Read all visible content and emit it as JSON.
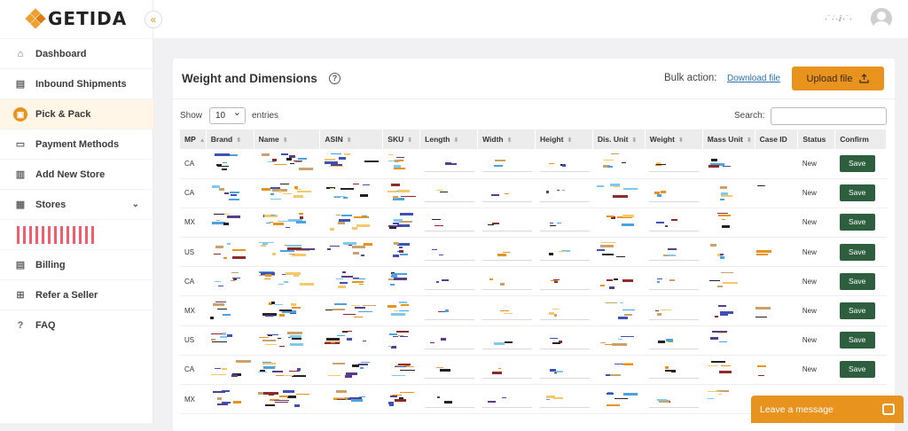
{
  "app": {
    "name": "GETIDA"
  },
  "sidebar": {
    "collapse_icon": "«",
    "items": [
      {
        "label": "Dashboard",
        "icon": "home-icon"
      },
      {
        "label": "Inbound Shipments",
        "icon": "truck-icon"
      },
      {
        "label": "Pick & Pack",
        "icon": "box-icon",
        "active": true
      },
      {
        "label": "Payment Methods",
        "icon": "card-icon"
      },
      {
        "label": "Add New Store",
        "icon": "store-icon"
      },
      {
        "label": "Stores",
        "icon": "stores-icon",
        "expandable": true
      },
      {
        "label": "Billing",
        "icon": "billing-icon"
      },
      {
        "label": "Refer a Seller",
        "icon": "gift-icon"
      },
      {
        "label": "FAQ",
        "icon": "help-icon"
      }
    ]
  },
  "topbar": {
    "username": "·˙·̇·ⅈ·˙·"
  },
  "card": {
    "title": "Weight and Dimensions",
    "help_symbol": "?",
    "bulk_label": "Bulk action:",
    "download_label": "Download file",
    "upload_label": "Upload file",
    "show_label": "Show",
    "entries_value": "10",
    "entries_label": "entries",
    "search_label": "Search:",
    "search_value": ""
  },
  "table": {
    "columns": [
      "MP",
      "Brand",
      "Name",
      "ASIN",
      "SKU",
      "Length",
      "Width",
      "Height",
      "Dis. Unit",
      "Weight",
      "Mass Unit",
      "Case ID",
      "Status",
      "Confirm"
    ],
    "rows": [
      {
        "mp": "CA",
        "status": "New",
        "action": "Save"
      },
      {
        "mp": "CA",
        "status": "New",
        "action": "Save"
      },
      {
        "mp": "MX",
        "status": "New",
        "action": "Save"
      },
      {
        "mp": "US",
        "status": "New",
        "action": "Save"
      },
      {
        "mp": "CA",
        "status": "New",
        "action": "Save"
      },
      {
        "mp": "MX",
        "status": "New",
        "action": "Save"
      },
      {
        "mp": "US",
        "status": "New",
        "action": "Save"
      },
      {
        "mp": "CA",
        "status": "New",
        "action": "Save"
      },
      {
        "mp": "MX",
        "status": "",
        "action": ""
      }
    ]
  },
  "chat": {
    "label": "Leave a message"
  },
  "colors": {
    "accent": "#e8931e",
    "save": "#2d5e3e",
    "stores_bars": "#f25c6b"
  }
}
